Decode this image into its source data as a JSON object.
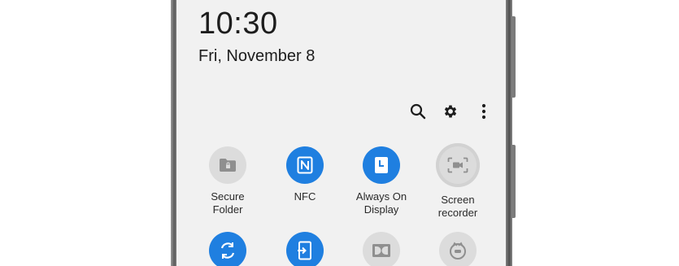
{
  "status": {
    "time": "10:30",
    "date": "Fri, November 8"
  },
  "toolbar": {
    "icons": [
      "search-icon",
      "gear-icon",
      "more-vertical-icon"
    ]
  },
  "tiles": [
    {
      "label": "Secure\nFolder",
      "icon": "folder-lock-icon",
      "state": "off"
    },
    {
      "label": "NFC",
      "icon": "nfc-icon",
      "state": "on"
    },
    {
      "label": "Always On\nDisplay",
      "icon": "always-on-display-icon",
      "state": "on"
    },
    {
      "label": "Screen\nrecorder",
      "icon": "screen-recorder-icon",
      "state": "off"
    },
    {
      "label": "",
      "icon": "auto-rotate-icon",
      "state": "on"
    },
    {
      "label": "",
      "icon": "smart-view-icon",
      "state": "on"
    },
    {
      "label": "",
      "icon": "dolby-atmos-icon",
      "state": "off"
    },
    {
      "label": "",
      "icon": "game-icon",
      "state": "off"
    }
  ],
  "colors": {
    "accent": "#1f7fe0",
    "tile_off": "#dcdcdc",
    "screen_bg": "#f1f1f1",
    "text": "#1d1d1d"
  }
}
